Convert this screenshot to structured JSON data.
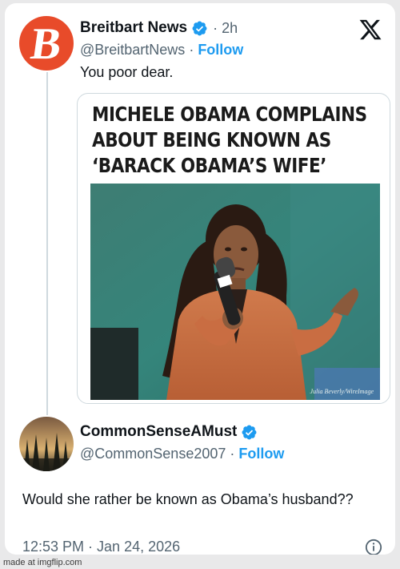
{
  "post": {
    "author_name": "Breitbart News",
    "author_avatar_letter": "B",
    "time": "· 2h",
    "handle": "@BreitbartNews",
    "separator": "·",
    "follow_label": "Follow",
    "text": "You poor dear.",
    "media": {
      "headline_lines": [
        "MICHELE OBAMA COMPLAINS",
        "ABOUT BEING KNOWN AS",
        "‘BARACK OBAMA’S WIFE’"
      ],
      "photo_credit": "Julia Beverly/WireImage"
    }
  },
  "reply": {
    "author_name": "CommonSenseAMust",
    "handle": "@CommonSense2007",
    "separator": "·",
    "follow_label": "Follow",
    "text": "Would she rather be known as Obama’s husband??",
    "timestamp": "12:53 PM · Jan 24, 2026"
  },
  "watermark": "made at imgflip.com",
  "colors": {
    "brand_red": "#e84b2a",
    "link_blue": "#1d9bf0",
    "verified_blue": "#1d9bf0",
    "muted_text": "#536471"
  },
  "icons": [
    "verified-badge-icon",
    "x-logo-icon",
    "info-icon"
  ]
}
